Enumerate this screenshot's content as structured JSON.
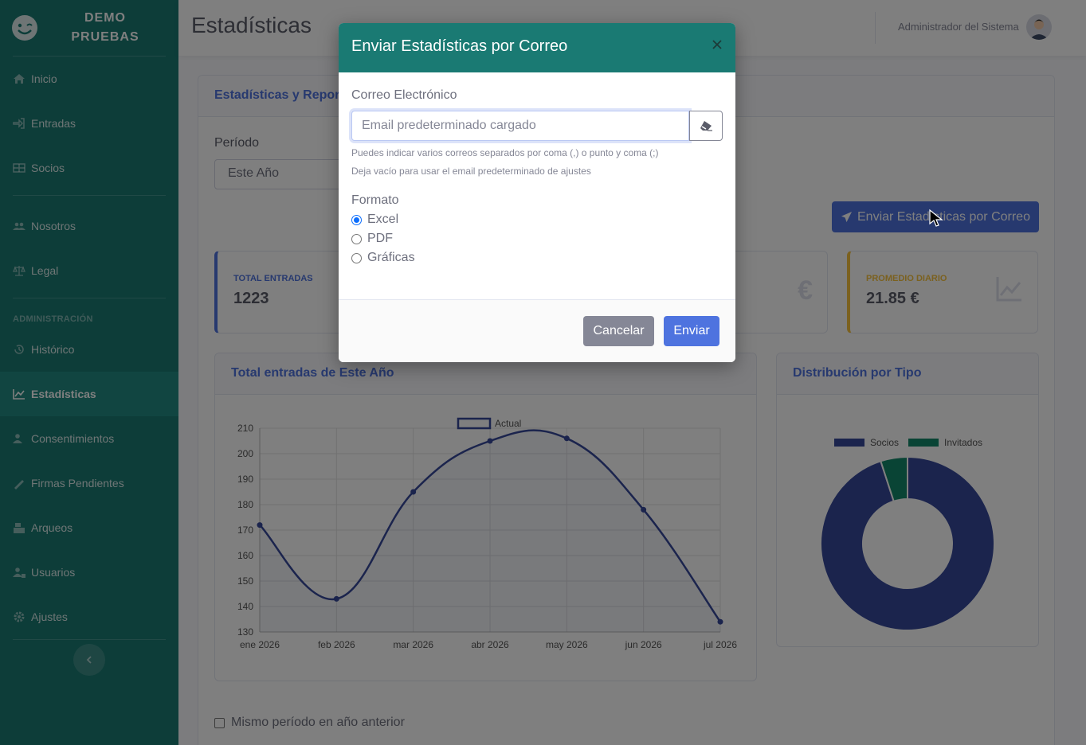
{
  "brand": {
    "line1": "DEMO",
    "line2": "PRUEBAS"
  },
  "sidebar": {
    "items": [
      {
        "label": "Inicio",
        "icon": "home-icon"
      },
      {
        "label": "Entradas",
        "icon": "sign-in-icon"
      },
      {
        "label": "Socios",
        "icon": "table-icon"
      },
      {
        "label": "Nosotros",
        "icon": "users-icon"
      },
      {
        "label": "Legal",
        "icon": "balance-scale-icon"
      }
    ],
    "admin_heading": "ADMINISTRACIÓN",
    "admin_items": [
      {
        "label": "Histórico",
        "icon": "history-icon"
      },
      {
        "label": "Estadísticas",
        "icon": "chart-line-icon",
        "active": true
      },
      {
        "label": "Consentimientos",
        "icon": "user-check-icon"
      },
      {
        "label": "Firmas Pendientes",
        "icon": "signature-icon"
      },
      {
        "label": "Arqueos",
        "icon": "cash-register-icon"
      },
      {
        "label": "Usuarios",
        "icon": "user-lock-icon"
      },
      {
        "label": "Ajustes",
        "icon": "gear-icon"
      }
    ]
  },
  "topbar": {
    "title": "Estadísticas",
    "user": "Administrador del Sistema"
  },
  "main": {
    "card_title": "Estadísticas y Reportes",
    "period_label": "Período",
    "period_value": "Este Año",
    "send_button": "Enviar Estadísticas por Correo",
    "stats": [
      {
        "label": "TOTAL ENTRADAS",
        "value": "1223",
        "color": "#4e73df"
      },
      {
        "label": "PROMEDIO DIARIO",
        "value": "21.85 €",
        "color": "#f6c23e"
      }
    ],
    "checkbox_label": "Mismo período en año anterior"
  },
  "line_chart_title": "Total entradas de Este Año",
  "pie_chart_title": "Distribución por Tipo",
  "chart_data": [
    {
      "type": "line",
      "categories": [
        "ene 2026",
        "feb 2026",
        "mar 2026",
        "abr 2026",
        "may 2026",
        "jun 2026",
        "jul 2026"
      ],
      "series": [
        {
          "name": "Actual",
          "values": [
            172,
            143,
            185,
            205,
            206,
            178,
            134
          ],
          "color": "#36489a"
        }
      ],
      "yticks": [
        130,
        140,
        150,
        160,
        170,
        180,
        190,
        200,
        210
      ],
      "ylim": [
        130,
        210
      ],
      "grid": true,
      "legend": "top-center"
    },
    {
      "type": "pie",
      "labels": [
        "Socios",
        "Invitados"
      ],
      "values": [
        95,
        5
      ],
      "colors": [
        "#36489a",
        "#13896a"
      ],
      "legend": "top-center"
    }
  ],
  "modal": {
    "title": "Enviar Estadísticas por Correo",
    "email_label": "Correo Electrónico",
    "email_placeholder": "Email predeterminado cargado",
    "help1": "Puedes indicar varios correos separados por coma (,) o punto y coma (;)",
    "help2": "Deja vacío para usar el email predeterminado de ajustes",
    "format_label": "Formato",
    "formats": [
      {
        "label": "Excel",
        "checked": true
      },
      {
        "label": "PDF",
        "checked": false
      },
      {
        "label": "Gráficas",
        "checked": false
      }
    ],
    "cancel": "Cancelar",
    "send": "Enviar"
  }
}
